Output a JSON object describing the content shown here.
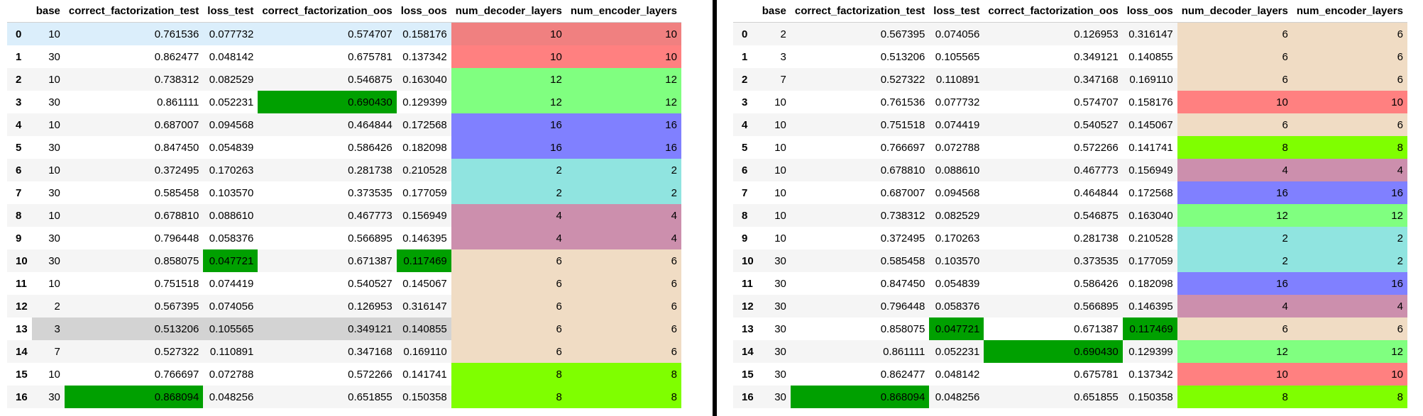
{
  "colors": {
    "green": "#00a000",
    "grey": "#d3d3d3",
    "red": "#f08080",
    "lred": "#ff8080",
    "lgreen": "#80ff80",
    "blue": "#8080ff",
    "teal": "#90e4e0",
    "mauve": "#cc8fad",
    "tan": "#f0dcc4",
    "lime": "#7fff00",
    "hover": "#dbeefb"
  },
  "tables": [
    {
      "columns": [
        "",
        "base",
        "correct_factorization_test",
        "loss_test",
        "correct_factorization_oos",
        "loss_oos",
        "num_decoder_layers",
        "num_encoder_layers"
      ],
      "rows": [
        {
          "idx": "0",
          "hover": true,
          "cells": [
            {
              "v": "10"
            },
            {
              "v": "0.761536"
            },
            {
              "v": "0.077732"
            },
            {
              "v": "0.574707"
            },
            {
              "v": "0.158176"
            },
            {
              "v": "10",
              "bg": "red"
            },
            {
              "v": "10",
              "bg": "red"
            }
          ]
        },
        {
          "idx": "1",
          "cells": [
            {
              "v": "30"
            },
            {
              "v": "0.862477"
            },
            {
              "v": "0.048142"
            },
            {
              "v": "0.675781"
            },
            {
              "v": "0.137342"
            },
            {
              "v": "10",
              "bg": "lred"
            },
            {
              "v": "10",
              "bg": "lred"
            }
          ]
        },
        {
          "idx": "2",
          "cells": [
            {
              "v": "10"
            },
            {
              "v": "0.738312"
            },
            {
              "v": "0.082529"
            },
            {
              "v": "0.546875"
            },
            {
              "v": "0.163040"
            },
            {
              "v": "12",
              "bg": "lgreen"
            },
            {
              "v": "12",
              "bg": "lgreen"
            }
          ]
        },
        {
          "idx": "3",
          "cells": [
            {
              "v": "30"
            },
            {
              "v": "0.861111"
            },
            {
              "v": "0.052231"
            },
            {
              "v": "0.690430",
              "bg": "green"
            },
            {
              "v": "0.129399"
            },
            {
              "v": "12",
              "bg": "lgreen"
            },
            {
              "v": "12",
              "bg": "lgreen"
            }
          ]
        },
        {
          "idx": "4",
          "cells": [
            {
              "v": "10"
            },
            {
              "v": "0.687007"
            },
            {
              "v": "0.094568"
            },
            {
              "v": "0.464844"
            },
            {
              "v": "0.172568"
            },
            {
              "v": "16",
              "bg": "blue"
            },
            {
              "v": "16",
              "bg": "blue"
            }
          ]
        },
        {
          "idx": "5",
          "cells": [
            {
              "v": "30"
            },
            {
              "v": "0.847450"
            },
            {
              "v": "0.054839"
            },
            {
              "v": "0.586426"
            },
            {
              "v": "0.182098"
            },
            {
              "v": "16",
              "bg": "blue"
            },
            {
              "v": "16",
              "bg": "blue"
            }
          ]
        },
        {
          "idx": "6",
          "cells": [
            {
              "v": "10"
            },
            {
              "v": "0.372495"
            },
            {
              "v": "0.170263"
            },
            {
              "v": "0.281738"
            },
            {
              "v": "0.210528"
            },
            {
              "v": "2",
              "bg": "teal"
            },
            {
              "v": "2",
              "bg": "teal"
            }
          ]
        },
        {
          "idx": "7",
          "cells": [
            {
              "v": "30"
            },
            {
              "v": "0.585458"
            },
            {
              "v": "0.103570"
            },
            {
              "v": "0.373535"
            },
            {
              "v": "0.177059"
            },
            {
              "v": "2",
              "bg": "teal"
            },
            {
              "v": "2",
              "bg": "teal"
            }
          ]
        },
        {
          "idx": "8",
          "cells": [
            {
              "v": "10"
            },
            {
              "v": "0.678810"
            },
            {
              "v": "0.088610"
            },
            {
              "v": "0.467773"
            },
            {
              "v": "0.156949"
            },
            {
              "v": "4",
              "bg": "mauve"
            },
            {
              "v": "4",
              "bg": "mauve"
            }
          ]
        },
        {
          "idx": "9",
          "cells": [
            {
              "v": "30"
            },
            {
              "v": "0.796448"
            },
            {
              "v": "0.058376"
            },
            {
              "v": "0.566895"
            },
            {
              "v": "0.146395"
            },
            {
              "v": "4",
              "bg": "mauve"
            },
            {
              "v": "4",
              "bg": "mauve"
            }
          ]
        },
        {
          "idx": "10",
          "cells": [
            {
              "v": "30"
            },
            {
              "v": "0.858075"
            },
            {
              "v": "0.047721",
              "bg": "green"
            },
            {
              "v": "0.671387"
            },
            {
              "v": "0.117469",
              "bg": "green"
            },
            {
              "v": "6",
              "bg": "tan"
            },
            {
              "v": "6",
              "bg": "tan"
            }
          ]
        },
        {
          "idx": "11",
          "cells": [
            {
              "v": "10"
            },
            {
              "v": "0.751518"
            },
            {
              "v": "0.074419"
            },
            {
              "v": "0.540527"
            },
            {
              "v": "0.145067"
            },
            {
              "v": "6",
              "bg": "tan"
            },
            {
              "v": "6",
              "bg": "tan"
            }
          ]
        },
        {
          "idx": "12",
          "cells": [
            {
              "v": "2"
            },
            {
              "v": "0.567395"
            },
            {
              "v": "0.074056"
            },
            {
              "v": "0.126953"
            },
            {
              "v": "0.316147"
            },
            {
              "v": "6",
              "bg": "tan"
            },
            {
              "v": "6",
              "bg": "tan"
            }
          ]
        },
        {
          "idx": "13",
          "cells": [
            {
              "v": "3",
              "bg": "grey"
            },
            {
              "v": "0.513206",
              "bg": "grey"
            },
            {
              "v": "0.105565",
              "bg": "grey"
            },
            {
              "v": "0.349121",
              "bg": "grey"
            },
            {
              "v": "0.140855",
              "bg": "grey"
            },
            {
              "v": "6",
              "bg": "tan"
            },
            {
              "v": "6",
              "bg": "tan"
            }
          ]
        },
        {
          "idx": "14",
          "cells": [
            {
              "v": "7"
            },
            {
              "v": "0.527322"
            },
            {
              "v": "0.110891"
            },
            {
              "v": "0.347168"
            },
            {
              "v": "0.169110"
            },
            {
              "v": "6",
              "bg": "tan"
            },
            {
              "v": "6",
              "bg": "tan"
            }
          ]
        },
        {
          "idx": "15",
          "cells": [
            {
              "v": "10"
            },
            {
              "v": "0.766697"
            },
            {
              "v": "0.072788"
            },
            {
              "v": "0.572266"
            },
            {
              "v": "0.141741"
            },
            {
              "v": "8",
              "bg": "lime"
            },
            {
              "v": "8",
              "bg": "lime"
            }
          ]
        },
        {
          "idx": "16",
          "cells": [
            {
              "v": "30"
            },
            {
              "v": "0.868094",
              "bg": "green"
            },
            {
              "v": "0.048256"
            },
            {
              "v": "0.651855"
            },
            {
              "v": "0.150358"
            },
            {
              "v": "8",
              "bg": "lime"
            },
            {
              "v": "8",
              "bg": "lime"
            }
          ]
        }
      ]
    },
    {
      "columns": [
        "",
        "base",
        "correct_factorization_test",
        "loss_test",
        "correct_factorization_oos",
        "loss_oos",
        "num_decoder_layers",
        "num_encoder_layers"
      ],
      "rows": [
        {
          "idx": "0",
          "cells": [
            {
              "v": "2"
            },
            {
              "v": "0.567395"
            },
            {
              "v": "0.074056"
            },
            {
              "v": "0.126953"
            },
            {
              "v": "0.316147"
            },
            {
              "v": "6",
              "bg": "tan"
            },
            {
              "v": "6",
              "bg": "tan"
            }
          ]
        },
        {
          "idx": "1",
          "cells": [
            {
              "v": "3"
            },
            {
              "v": "0.513206"
            },
            {
              "v": "0.105565"
            },
            {
              "v": "0.349121"
            },
            {
              "v": "0.140855"
            },
            {
              "v": "6",
              "bg": "tan"
            },
            {
              "v": "6",
              "bg": "tan"
            }
          ]
        },
        {
          "idx": "2",
          "cells": [
            {
              "v": "7"
            },
            {
              "v": "0.527322"
            },
            {
              "v": "0.110891"
            },
            {
              "v": "0.347168"
            },
            {
              "v": "0.169110"
            },
            {
              "v": "6",
              "bg": "tan"
            },
            {
              "v": "6",
              "bg": "tan"
            }
          ]
        },
        {
          "idx": "3",
          "cells": [
            {
              "v": "10"
            },
            {
              "v": "0.761536"
            },
            {
              "v": "0.077732"
            },
            {
              "v": "0.574707"
            },
            {
              "v": "0.158176"
            },
            {
              "v": "10",
              "bg": "lred"
            },
            {
              "v": "10",
              "bg": "lred"
            }
          ]
        },
        {
          "idx": "4",
          "cells": [
            {
              "v": "10"
            },
            {
              "v": "0.751518"
            },
            {
              "v": "0.074419"
            },
            {
              "v": "0.540527"
            },
            {
              "v": "0.145067"
            },
            {
              "v": "6",
              "bg": "tan"
            },
            {
              "v": "6",
              "bg": "tan"
            }
          ]
        },
        {
          "idx": "5",
          "cells": [
            {
              "v": "10"
            },
            {
              "v": "0.766697"
            },
            {
              "v": "0.072788"
            },
            {
              "v": "0.572266"
            },
            {
              "v": "0.141741"
            },
            {
              "v": "8",
              "bg": "lime"
            },
            {
              "v": "8",
              "bg": "lime"
            }
          ]
        },
        {
          "idx": "6",
          "cells": [
            {
              "v": "10"
            },
            {
              "v": "0.678810"
            },
            {
              "v": "0.088610"
            },
            {
              "v": "0.467773"
            },
            {
              "v": "0.156949"
            },
            {
              "v": "4",
              "bg": "mauve"
            },
            {
              "v": "4",
              "bg": "mauve"
            }
          ]
        },
        {
          "idx": "7",
          "cells": [
            {
              "v": "10"
            },
            {
              "v": "0.687007"
            },
            {
              "v": "0.094568"
            },
            {
              "v": "0.464844"
            },
            {
              "v": "0.172568"
            },
            {
              "v": "16",
              "bg": "blue"
            },
            {
              "v": "16",
              "bg": "blue"
            }
          ]
        },
        {
          "idx": "8",
          "cells": [
            {
              "v": "10"
            },
            {
              "v": "0.738312"
            },
            {
              "v": "0.082529"
            },
            {
              "v": "0.546875"
            },
            {
              "v": "0.163040"
            },
            {
              "v": "12",
              "bg": "lgreen"
            },
            {
              "v": "12",
              "bg": "lgreen"
            }
          ]
        },
        {
          "idx": "9",
          "cells": [
            {
              "v": "10"
            },
            {
              "v": "0.372495"
            },
            {
              "v": "0.170263"
            },
            {
              "v": "0.281738"
            },
            {
              "v": "0.210528"
            },
            {
              "v": "2",
              "bg": "teal"
            },
            {
              "v": "2",
              "bg": "teal"
            }
          ]
        },
        {
          "idx": "10",
          "cells": [
            {
              "v": "30"
            },
            {
              "v": "0.585458"
            },
            {
              "v": "0.103570"
            },
            {
              "v": "0.373535"
            },
            {
              "v": "0.177059"
            },
            {
              "v": "2",
              "bg": "teal"
            },
            {
              "v": "2",
              "bg": "teal"
            }
          ]
        },
        {
          "idx": "11",
          "cells": [
            {
              "v": "30"
            },
            {
              "v": "0.847450"
            },
            {
              "v": "0.054839"
            },
            {
              "v": "0.586426"
            },
            {
              "v": "0.182098"
            },
            {
              "v": "16",
              "bg": "blue"
            },
            {
              "v": "16",
              "bg": "blue"
            }
          ]
        },
        {
          "idx": "12",
          "cells": [
            {
              "v": "30"
            },
            {
              "v": "0.796448"
            },
            {
              "v": "0.058376"
            },
            {
              "v": "0.566895"
            },
            {
              "v": "0.146395"
            },
            {
              "v": "4",
              "bg": "mauve"
            },
            {
              "v": "4",
              "bg": "mauve"
            }
          ]
        },
        {
          "idx": "13",
          "cells": [
            {
              "v": "30"
            },
            {
              "v": "0.858075"
            },
            {
              "v": "0.047721",
              "bg": "green"
            },
            {
              "v": "0.671387"
            },
            {
              "v": "0.117469",
              "bg": "green"
            },
            {
              "v": "6",
              "bg": "tan"
            },
            {
              "v": "6",
              "bg": "tan"
            }
          ]
        },
        {
          "idx": "14",
          "cells": [
            {
              "v": "30"
            },
            {
              "v": "0.861111"
            },
            {
              "v": "0.052231"
            },
            {
              "v": "0.690430",
              "bg": "green"
            },
            {
              "v": "0.129399"
            },
            {
              "v": "12",
              "bg": "lgreen"
            },
            {
              "v": "12",
              "bg": "lgreen"
            }
          ]
        },
        {
          "idx": "15",
          "cells": [
            {
              "v": "30"
            },
            {
              "v": "0.862477"
            },
            {
              "v": "0.048142"
            },
            {
              "v": "0.675781"
            },
            {
              "v": "0.137342"
            },
            {
              "v": "10",
              "bg": "lred"
            },
            {
              "v": "10",
              "bg": "lred"
            }
          ]
        },
        {
          "idx": "16",
          "cells": [
            {
              "v": "30"
            },
            {
              "v": "0.868094",
              "bg": "green"
            },
            {
              "v": "0.048256"
            },
            {
              "v": "0.651855"
            },
            {
              "v": "0.150358"
            },
            {
              "v": "8",
              "bg": "lime"
            },
            {
              "v": "8",
              "bg": "lime"
            }
          ]
        }
      ]
    }
  ]
}
